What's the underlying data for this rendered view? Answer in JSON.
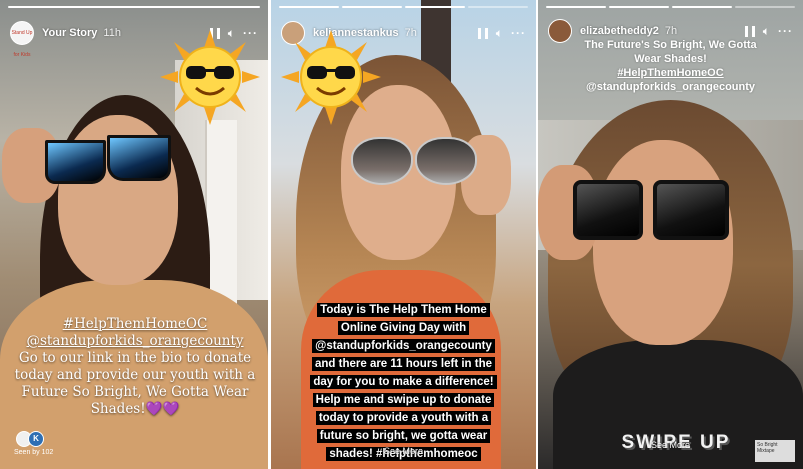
{
  "stories": [
    {
      "user": "Your Story",
      "time": "11h",
      "avatar_text": "Stand Up for Kids",
      "caption": {
        "hashtag": "#HelpThemHomeOC",
        "mention": "@standupforkids_orangecounty",
        "body": "Go to our link in the bio to donate today and provide our youth with a Future So Bright, We Gotta Wear Shades!",
        "emoji": "💜💜"
      },
      "seen_by": "Seen by 102"
    },
    {
      "user": "keliannestankus",
      "time": "7h",
      "caption_lines": [
        "Today is The Help Them Home",
        "Online Giving Day with",
        "@standupforkids_orangecounty",
        "and there are 11 hours left in the",
        "day for you to make a difference!",
        "Help me and swipe up to donate",
        "today to provide a youth with a",
        "future so bright, we gotta wear",
        "shades! #helpthemhomeoc"
      ],
      "see_more": "See More"
    },
    {
      "user": "elizabetheddy2",
      "time": "7h",
      "caption_lines": [
        "The Future's So Bright, We Gotta",
        "Wear Shades!",
        "#HelpThemHomeOC",
        "@standupforkids_orangecounty"
      ],
      "swipe_up": "SWIPE UP",
      "see_more": "See More",
      "music_label": "So Bright Mixtape"
    }
  ],
  "icons": {
    "pause": "pause-icon",
    "volume": "volume-icon",
    "more": "more-icon",
    "sun": "sun-sunglasses-sticker"
  },
  "colors": {
    "caption_bg": "#000000",
    "caption_text": "#ffffff",
    "hearts": "#8e44d6"
  }
}
